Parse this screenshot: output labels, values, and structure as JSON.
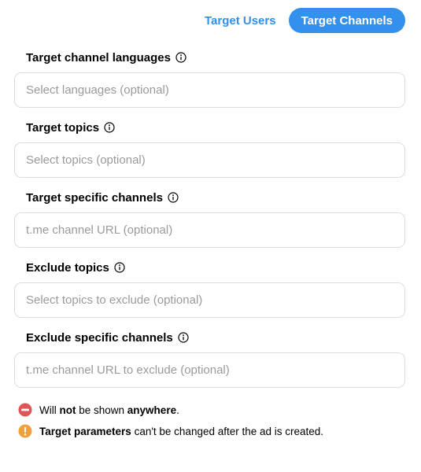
{
  "tabs": {
    "target_users": "Target Users",
    "target_channels": "Target Channels"
  },
  "fields": [
    {
      "label": "Target channel languages",
      "placeholder": "Select languages (optional)"
    },
    {
      "label": "Target topics",
      "placeholder": "Select topics (optional)"
    },
    {
      "label": "Target specific channels",
      "placeholder": "t.me channel URL (optional)"
    },
    {
      "label": "Exclude topics",
      "placeholder": "Select topics to exclude (optional)"
    },
    {
      "label": "Exclude specific channels",
      "placeholder": "t.me channel URL to exclude (optional)"
    }
  ],
  "notes": {
    "shown": {
      "prefix": "Will ",
      "emphasis": "not",
      "middle": " be shown ",
      "emphasis2": "anywhere",
      "suffix": "."
    },
    "warning": {
      "emphasis": "Target parameters",
      "suffix": " can't be changed after the ad is created."
    }
  },
  "colors": {
    "accent": "#3390ec",
    "danger": "#e05656",
    "warning": "#f0a03a",
    "border": "#dadce0",
    "placeholder": "#9a9a9a"
  },
  "icons": {
    "info": "info-circle-icon",
    "no_entry": "no-entry-icon",
    "warning": "warning-circle-icon"
  }
}
